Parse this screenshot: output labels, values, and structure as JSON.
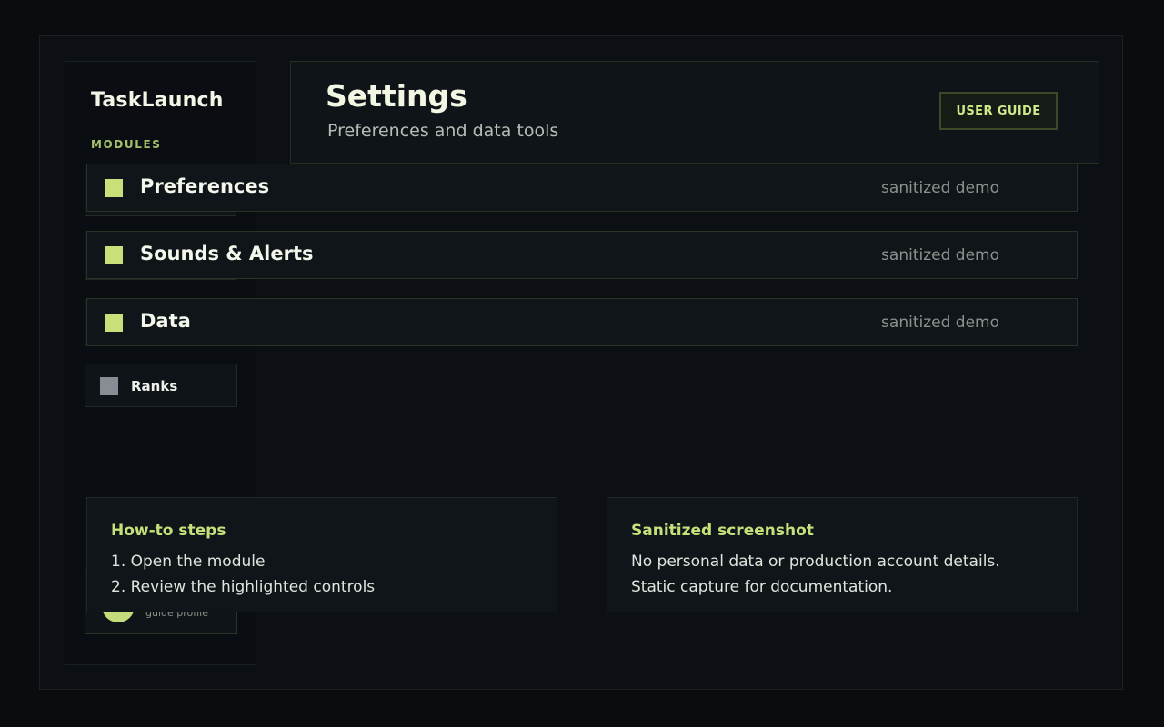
{
  "app": {
    "name": "TaskLaunch",
    "modules_label": "MODULES"
  },
  "header": {
    "title": "Settings",
    "subtitle": "Preferences and data tools",
    "guide_button": "USER GUIDE"
  },
  "modules": [
    {
      "label": "Preferences",
      "tag": "sanitized demo"
    },
    {
      "label": "Sounds & Alerts",
      "tag": "sanitized demo"
    },
    {
      "label": "Data",
      "tag": "sanitized demo"
    }
  ],
  "sidebar": {
    "ranks_label": "Ranks",
    "profile_sub": "guide profile"
  },
  "howto": {
    "title": "How-to steps",
    "lines": [
      "1. Open the module",
      "2. Review the highlighted controls"
    ]
  },
  "sanitized": {
    "title": "Sanitized screenshot",
    "lines": [
      "No personal data or production account details.",
      "Static capture for documentation."
    ]
  },
  "colors": {
    "accent": "#c9e07a",
    "background": "#0a0c0f",
    "panel": "#10151a",
    "muted_square": "#878c95"
  }
}
